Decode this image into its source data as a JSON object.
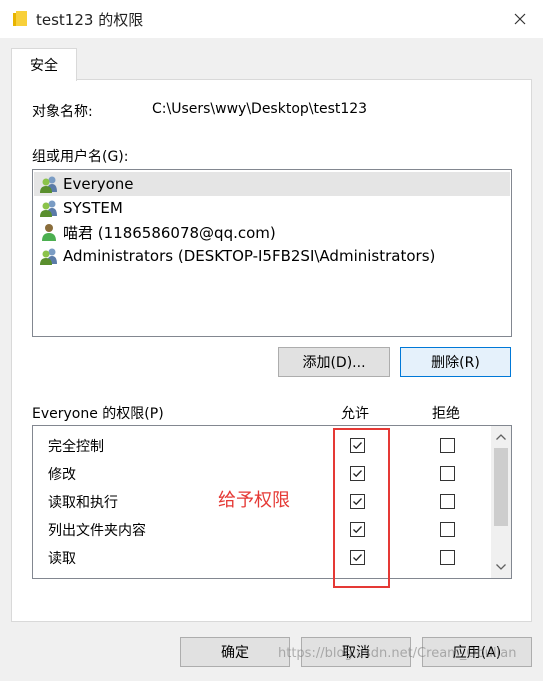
{
  "window": {
    "title": "test123 的权限"
  },
  "tabs": [
    {
      "label": "安全"
    }
  ],
  "object": {
    "label": "对象名称:",
    "value": "C:\\Users\\wwy\\Desktop\\test123"
  },
  "groups": {
    "label": "组或用户名(G):",
    "items": [
      {
        "name": "Everyone",
        "icon": "group-icon",
        "selected": true
      },
      {
        "name": "SYSTEM",
        "icon": "group-icon",
        "selected": false
      },
      {
        "name": "喵君 (1186586078@qq.com)",
        "icon": "user-icon",
        "selected": false
      },
      {
        "name": "Administrators (DESKTOP-I5FB2SI\\Administrators)",
        "icon": "group-icon",
        "selected": false
      }
    ]
  },
  "buttons": {
    "add": "添加(D)...",
    "remove": "删除(R)"
  },
  "permissions": {
    "label": "Everyone 的权限(P)",
    "allow_label": "允许",
    "deny_label": "拒绝",
    "rows": [
      {
        "name": "完全控制",
        "allow": true,
        "deny": false
      },
      {
        "name": "修改",
        "allow": true,
        "deny": false
      },
      {
        "name": "读取和执行",
        "allow": true,
        "deny": false
      },
      {
        "name": "列出文件夹内容",
        "allow": true,
        "deny": false
      },
      {
        "name": "读取",
        "allow": true,
        "deny": false
      }
    ]
  },
  "annotation": {
    "text": "给予权限",
    "color": "#e53935"
  },
  "footer": {
    "ok": "确定",
    "cancel": "取消",
    "apply": "应用(A)"
  },
  "watermark": "https://blog.csdn.net/Cream_Obulian"
}
